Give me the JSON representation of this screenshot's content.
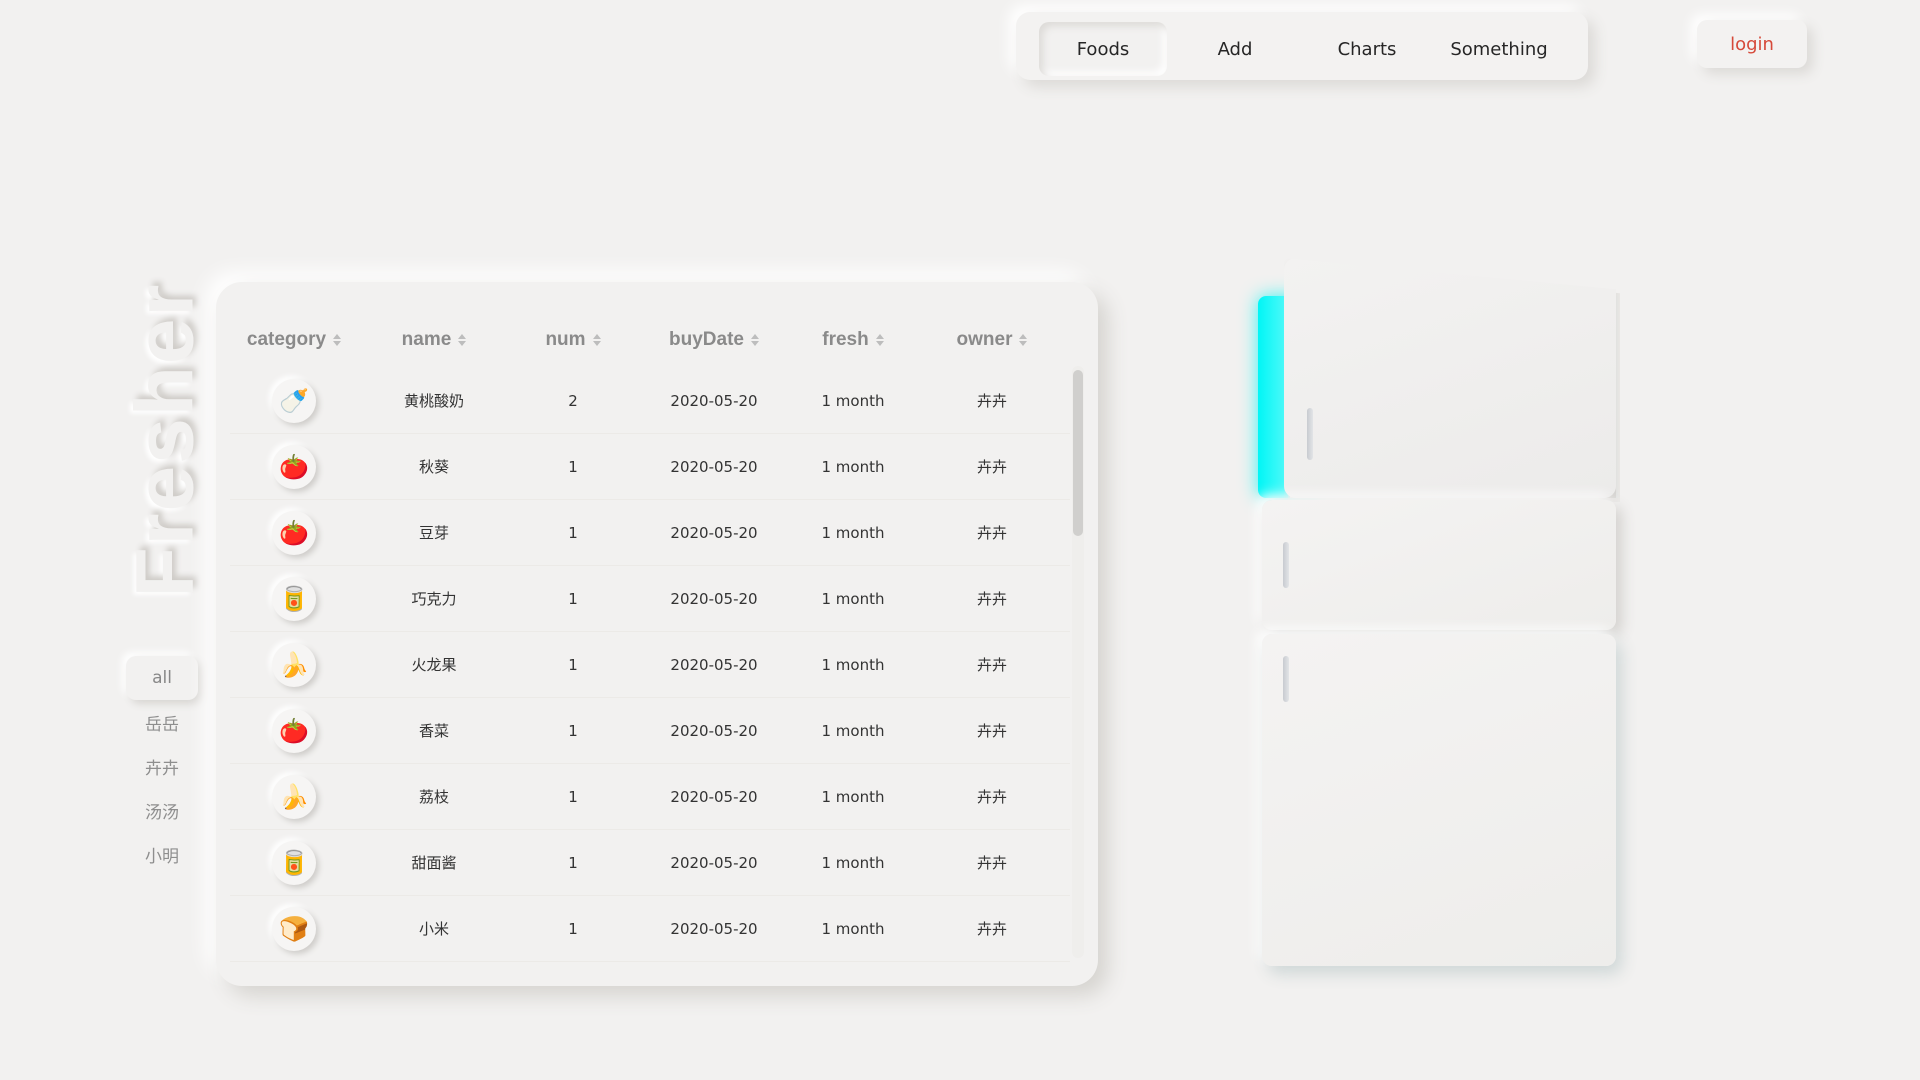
{
  "nav": {
    "items": [
      {
        "label": "Foods",
        "active": true
      },
      {
        "label": "Add",
        "active": false
      },
      {
        "label": "Charts",
        "active": false
      },
      {
        "label": "Something",
        "active": false
      }
    ],
    "login_label": "login"
  },
  "brand": {
    "title": "Fresher"
  },
  "filter": {
    "items": [
      {
        "label": "all",
        "active": true
      },
      {
        "label": "岳岳",
        "active": false
      },
      {
        "label": "卉卉",
        "active": false
      },
      {
        "label": "汤汤",
        "active": false
      },
      {
        "label": "小明",
        "active": false
      }
    ]
  },
  "table": {
    "headers": [
      "category",
      "name",
      "num",
      "buyDate",
      "fresh",
      "owner"
    ],
    "rows": [
      {
        "category_icon": "🍼",
        "name": "黄桃酸奶",
        "num": "2",
        "buyDate": "2020-05-20",
        "fresh": "1 month",
        "owner": "卉卉"
      },
      {
        "category_icon": "🍅",
        "name": "秋葵",
        "num": "1",
        "buyDate": "2020-05-20",
        "fresh": "1 month",
        "owner": "卉卉"
      },
      {
        "category_icon": "🍅",
        "name": "豆芽",
        "num": "1",
        "buyDate": "2020-05-20",
        "fresh": "1 month",
        "owner": "卉卉"
      },
      {
        "category_icon": "🥫",
        "name": "巧克力",
        "num": "1",
        "buyDate": "2020-05-20",
        "fresh": "1 month",
        "owner": "卉卉"
      },
      {
        "category_icon": "🍌",
        "name": "火龙果",
        "num": "1",
        "buyDate": "2020-05-20",
        "fresh": "1 month",
        "owner": "卉卉"
      },
      {
        "category_icon": "🍅",
        "name": "香菜",
        "num": "1",
        "buyDate": "2020-05-20",
        "fresh": "1 month",
        "owner": "卉卉"
      },
      {
        "category_icon": "🍌",
        "name": "荔枝",
        "num": "1",
        "buyDate": "2020-05-20",
        "fresh": "1 month",
        "owner": "卉卉"
      },
      {
        "category_icon": "🥫",
        "name": "甜面酱",
        "num": "1",
        "buyDate": "2020-05-20",
        "fresh": "1 month",
        "owner": "卉卉"
      },
      {
        "category_icon": "🍞",
        "name": "小米",
        "num": "1",
        "buyDate": "2020-05-20",
        "fresh": "1 month",
        "owner": "卉卉"
      }
    ]
  },
  "colors": {
    "background": "#f2f1f0",
    "login_text": "#d64a3a",
    "fridge_glow": "#00f6f6"
  }
}
